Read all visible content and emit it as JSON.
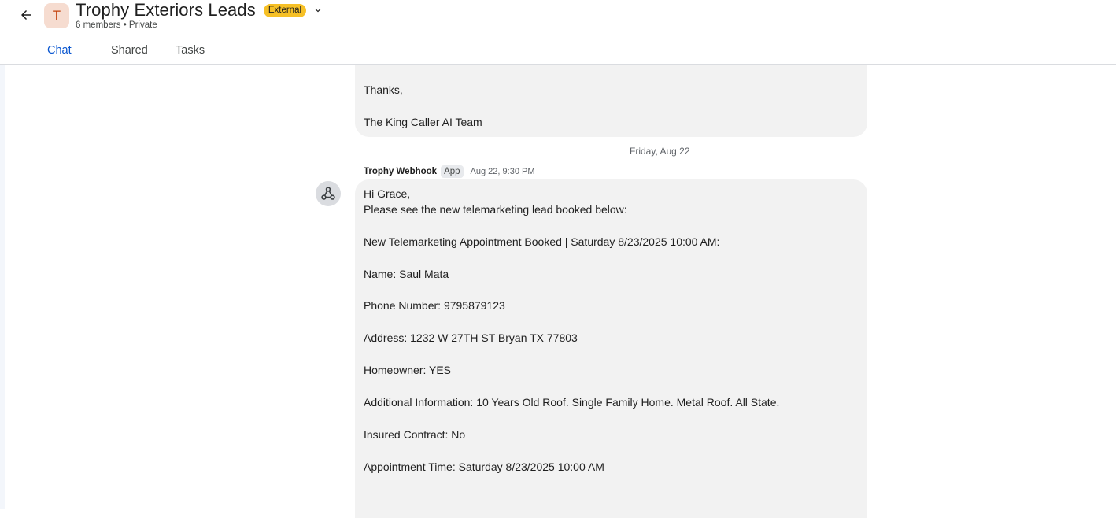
{
  "header": {
    "avatar_letter": "T",
    "title": "Trophy Exteriors Leads",
    "badge": "External",
    "subtitle": "6 members • Private",
    "tabs": [
      {
        "label": "Chat",
        "active": true
      },
      {
        "label": "Shared",
        "active": false
      },
      {
        "label": "Tasks",
        "active": false
      }
    ]
  },
  "previous_message": {
    "lines": [
      "Thanks,",
      "The King Caller AI Team"
    ]
  },
  "date_separator": "Friday, Aug 22",
  "message": {
    "sender": "Trophy Webhook",
    "sender_badge": "App",
    "time": "Aug 22, 9:30 PM",
    "lines": [
      "Hi Grace,",
      "Please see the new telemarketing lead booked below:",
      "New Telemarketing Appointment Booked | Saturday 8/23/2025 10:00 AM:",
      "Name: Saul Mata",
      "Phone Number: 9795879123",
      "Address: 1232 W 27TH ST Bryan TX 77803",
      "Homeowner: YES",
      "Additional Information: 10 Years Old Roof. Single Family Home. Metal Roof. All State.",
      "Insured Contract: No",
      "Appointment Time: Saturday 8/23/2025 10:00 AM"
    ]
  },
  "colors": {
    "accent": "#0b57d0",
    "badge": "#f6c026",
    "bubble": "#f2f2f2",
    "avatar_bg": "#f6dcd0"
  },
  "icons": [
    "back-arrow-icon",
    "chevron-down-icon",
    "webhook-icon"
  ]
}
